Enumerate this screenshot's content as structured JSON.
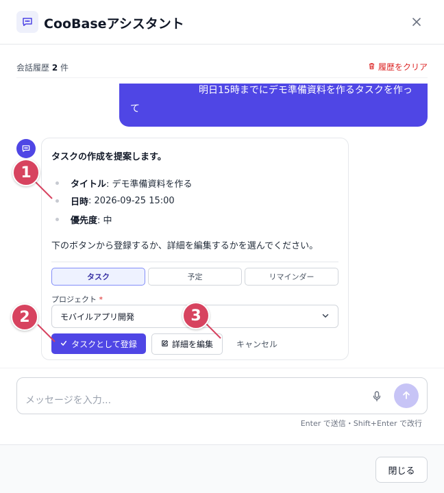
{
  "header": {
    "title": "CooBaseアシスタント"
  },
  "history": {
    "count_prefix": "会話履歴",
    "count_value": "2",
    "count_suffix": "件",
    "clear_label": "履歴をクリア"
  },
  "user_message": {
    "line1": "明日15時までにデモ準備資料を作るタスクを作っ",
    "line2": "て"
  },
  "bot_message": {
    "intro": "タスクの作成を提案します。",
    "details": [
      {
        "label": "タイトル",
        "value": ": デモ準備資料を作る"
      },
      {
        "label": "日時",
        "value": ": 2026-09-25 15:00"
      },
      {
        "label": "優先度",
        "value": ": 中"
      }
    ],
    "instruction": "下のボタンから登録するか、詳細を編集するかを選んでください。"
  },
  "tabs": [
    {
      "label": "タスク",
      "active": true
    },
    {
      "label": "予定",
      "active": false
    },
    {
      "label": "リマインダー",
      "active": false
    }
  ],
  "project": {
    "label": "プロジェクト",
    "required_mark": "*",
    "selected": "モバイルアプリ開発"
  },
  "actions": {
    "register_label": "タスクとして登録",
    "edit_label": "詳細を編集",
    "cancel_label": "キャンセル"
  },
  "callouts": [
    "1",
    "2",
    "3"
  ],
  "composer": {
    "placeholder": "メッセージを入力...",
    "hint": "Enter で送信・Shift+Enter で改行"
  },
  "footer": {
    "close_label": "閉じる"
  },
  "colors": {
    "accent": "#4f46e5",
    "callout": "#d7435f",
    "danger": "#dc2626"
  }
}
